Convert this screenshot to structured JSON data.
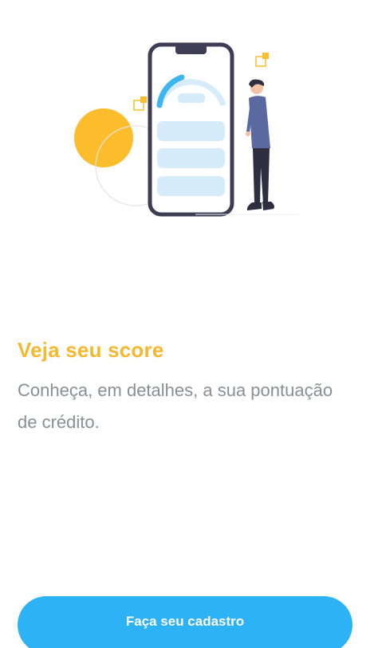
{
  "onboarding": {
    "title": "Veja seu score",
    "description": "Conheça, em detalhes, a sua pontuação de crédito.",
    "illustration_icon": "phone-score-illustration-icon"
  },
  "actions": {
    "signup_label": "Faça seu cadastro"
  },
  "colors": {
    "title": "#f5b82e",
    "text": "#8a8f96",
    "primary": "#2db3f5",
    "accent_yellow": "#fbbd2c",
    "phone_frame": "#3f3d56",
    "gauge": "#3cb5f0",
    "placeholder": "#d6ecfb"
  }
}
